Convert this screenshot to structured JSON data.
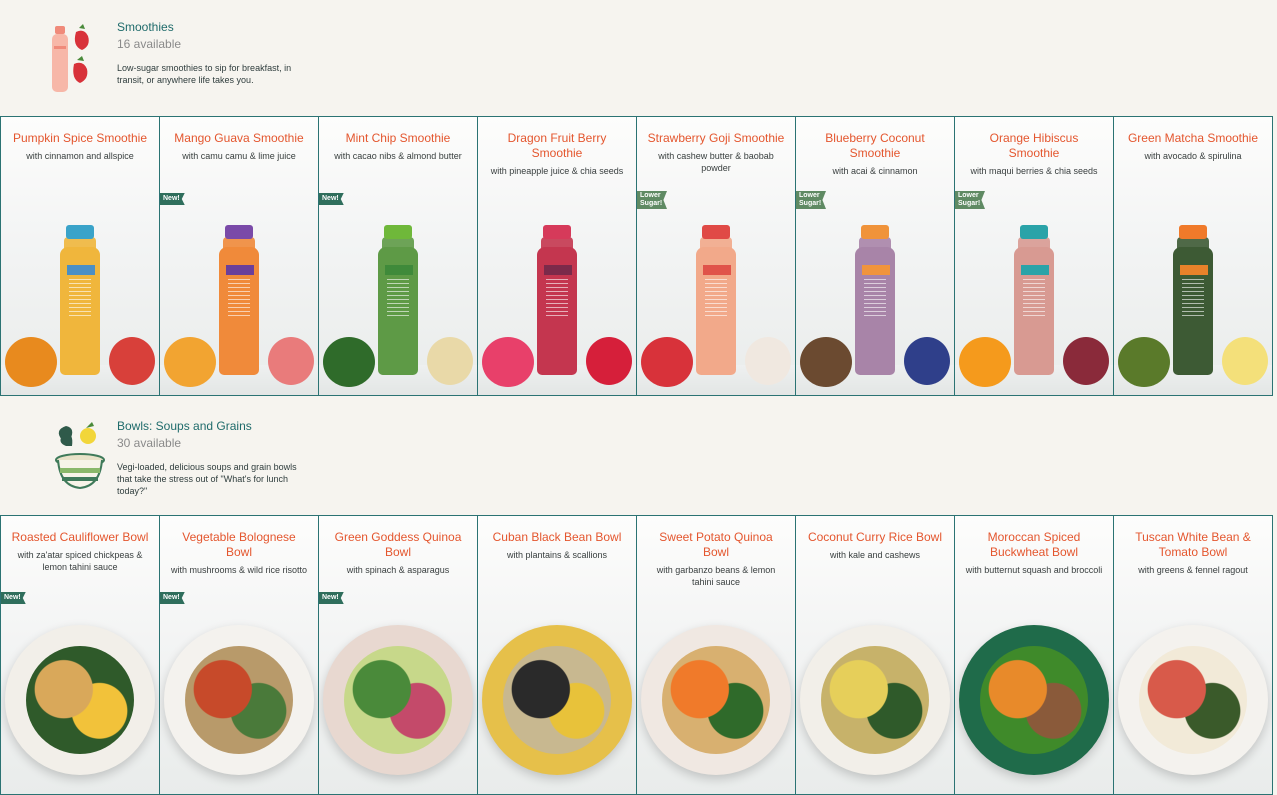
{
  "smoothies_section": {
    "title": "Smoothies",
    "count": "16 available",
    "description": "Low-sugar smoothies to sip for breakfast, in transit, or anywhere life takes you.",
    "icon": "smoothie-bottle-strawberry-icon"
  },
  "bowls_section": {
    "title": "Bowls: Soups and Grains",
    "count": "30 available",
    "description": "Vegi-loaded, delicious soups and grain bowls that take the stress out of \"What's for lunch today?\"",
    "icon": "bowl-greens-icon"
  },
  "smoothies": [
    {
      "name": "Pumpkin Spice Smoothie",
      "sub": "with cinnamon and allspice",
      "badge": "",
      "cap": "#3aa3c9",
      "body": "#f0b63c",
      "label": "#4b8fc4",
      "fruit1": "#e88a1e",
      "fruit2": "#d8403a"
    },
    {
      "name": "Mango Guava Smoothie",
      "sub": "with camu camu & lime juice",
      "badge": "New!",
      "cap": "#7a4aa8",
      "body": "#f08a3a",
      "label": "#6a3f9a",
      "fruit1": "#f2a431",
      "fruit2": "#e97b7b"
    },
    {
      "name": "Mint Chip Smoothie",
      "sub": "with cacao nibs & almond butter",
      "badge": "New!",
      "cap": "#6fb83a",
      "body": "#5e9a46",
      "label": "#3f8a3a",
      "fruit1": "#2f6b2a",
      "fruit2": "#e9d9a8"
    },
    {
      "name": "Dragon Fruit Berry Smoothie",
      "sub": "with pineapple juice & chia seeds",
      "badge": "",
      "cap": "#d63a5a",
      "body": "#c4364f",
      "label": "#7b2a4a",
      "fruit1": "#e8406a",
      "fruit2": "#d61f3a"
    },
    {
      "name": "Strawberry Goji Smoothie",
      "sub": "with cashew butter & baobab powder",
      "badge": "Lower Sugar!",
      "cap": "#e04a46",
      "body": "#f2a98a",
      "label": "#e0534a",
      "fruit1": "#d8323a",
      "fruit2": "#f0e8e0"
    },
    {
      "name": "Blueberry Coconut Smoothie",
      "sub": "with acai & cinnamon",
      "badge": "Lower Sugar!",
      "cap": "#f0933a",
      "body": "#a884a8",
      "label": "#f0943c",
      "fruit1": "#6b4a30",
      "fruit2": "#2f3f8a"
    },
    {
      "name": "Orange Hibiscus Smoothie",
      "sub": "with maqui berries & chia seeds",
      "badge": "Lower Sugar!",
      "cap": "#2aa3a8",
      "body": "#d89a92",
      "label": "#2aa3a8",
      "fruit1": "#f59a1c",
      "fruit2": "#8a2a3a"
    },
    {
      "name": "Green Matcha Smoothie",
      "sub": "with avocado & spirulina",
      "badge": "",
      "cap": "#f07a2a",
      "body": "#3d5a34",
      "label": "#e8822a",
      "fruit1": "#5a7a2a",
      "fruit2": "#f4e07a"
    }
  ],
  "bowls": [
    {
      "name": "Roasted Cauliflower Bowl",
      "sub": "with za'atar spiced chickpeas & lemon tahini sauce",
      "badge": "New!",
      "plate": "#f2efe9",
      "food1": "#d9a85a",
      "food2": "#2f5a2a",
      "food3": "#f2c23a"
    },
    {
      "name": "Vegetable Bolognese Bowl",
      "sub": "with mushrooms & wild rice risotto",
      "badge": "New!",
      "plate": "#f4f2ee",
      "food1": "#c74a2a",
      "food2": "#b89a6a",
      "food3": "#4a7a3a"
    },
    {
      "name": "Green Goddess Quinoa Bowl",
      "sub": "with spinach & asparagus",
      "badge": "New!",
      "plate": "#e8d8d0",
      "food1": "#4a8a3a",
      "food2": "#c7d88a",
      "food3": "#c44a6a"
    },
    {
      "name": "Cuban Black Bean Bowl",
      "sub": "with plantains & scallions",
      "badge": "",
      "plate": "#e6c04a",
      "food1": "#2a2a2a",
      "food2": "#c8b890",
      "food3": "#e8c23a"
    },
    {
      "name": "Sweet Potato Quinoa Bowl",
      "sub": "with garbanzo beans & lemon tahini sauce",
      "badge": "",
      "plate": "#f0e8e2",
      "food1": "#f07a2a",
      "food2": "#d8b070",
      "food3": "#2f6a2a"
    },
    {
      "name": "Coconut Curry Rice Bowl",
      "sub": "with kale and cashews",
      "badge": "",
      "plate": "#f2efe9",
      "food1": "#e6cf5a",
      "food2": "#c7b26a",
      "food3": "#2f5a2a"
    },
    {
      "name": "Moroccan Spiced Buckwheat Bowl",
      "sub": "with butternut squash and broccoli",
      "badge": "",
      "plate": "#1f6b4a",
      "food1": "#e88a2a",
      "food2": "#3f8a2a",
      "food3": "#8a5a3a"
    },
    {
      "name": "Tuscan White Bean & Tomato Bowl",
      "sub": "with greens & fennel ragout",
      "badge": "",
      "plate": "#f4f2ee",
      "food1": "#d85a4a",
      "food2": "#f2ead8",
      "food3": "#3a5a2a"
    }
  ]
}
